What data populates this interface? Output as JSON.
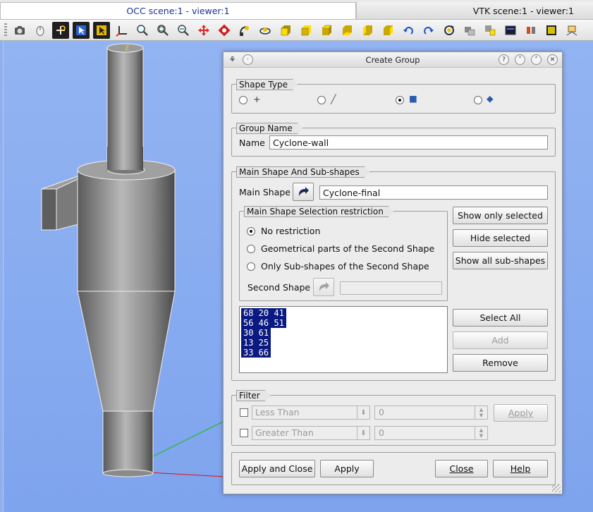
{
  "tabs": {
    "occ": "OCC scene:1 - viewer:1",
    "vtk": "VTK scene:1 - viewer:1"
  },
  "toolbar": {
    "icons": [
      "dump-view-icon",
      "mouse-icon",
      "fit-all-icon",
      "select-area-icon",
      "rectangle-zoom-icon",
      "global-pan-icon",
      "zoom-icon",
      "fit-area-icon",
      "zoom-out-icon",
      "pan-icon",
      "rotate-icon",
      "change-rotation-point-icon",
      "rotation-icon",
      "front-view-icon",
      "back-view-icon",
      "top-view-icon",
      "bottom-view-icon",
      "left-view-icon",
      "right-view-icon",
      "rotate-counterclockwise-icon",
      "rotate-clockwise-icon",
      "reset-view-icon",
      "clone-view-icon",
      "clipping-icon",
      "scaling-icon",
      "graduated-axes-icon",
      "trihedron-icon",
      "ray-tracing-icon"
    ]
  },
  "viewer": {
    "axis_label": "Z"
  },
  "dialog": {
    "title": "Create Group",
    "help_symbol": "?",
    "shape_type": {
      "legend": "Shape Type",
      "options": [
        {
          "symbol": "+",
          "selected": false
        },
        {
          "symbol": "╱",
          "selected": false
        },
        {
          "symbol": "■",
          "selected": true
        },
        {
          "symbol": "◆",
          "selected": false
        }
      ]
    },
    "group_name": {
      "legend": "Group Name",
      "label": "Name",
      "value": "Cyclone-wall"
    },
    "main_shape": {
      "legend": "Main Shape And Sub-shapes",
      "label": "Main Shape",
      "value": "Cyclone-final",
      "restriction": {
        "legend": "Main Shape Selection restriction",
        "options": [
          {
            "label": "No restriction",
            "selected": true
          },
          {
            "label": "Geometrical parts of the Second Shape",
            "selected": false
          },
          {
            "label": "Only Sub-shapes of the Second Shape",
            "selected": false
          }
        ],
        "second_shape_label": "Second Shape",
        "second_shape_value": ""
      },
      "buttons": {
        "show_only_selected": "Show only selected",
        "hide_selected": "Hide selected",
        "show_all": "Show all sub-shapes",
        "select_all": "Select All",
        "add": "Add",
        "remove": "Remove"
      },
      "ids": [
        "68  20  41",
        "56  46  51",
        "30  61",
        "13  25",
        "33  66"
      ]
    },
    "filter": {
      "legend": "Filter",
      "rows": [
        {
          "label": "Less Than",
          "value": "0",
          "checked": false
        },
        {
          "label": "Greater Than",
          "value": "0",
          "checked": false
        }
      ],
      "apply": "Apply"
    },
    "footer": {
      "apply_close": "Apply and Close",
      "apply": "Apply",
      "close": "Close",
      "help": "Help"
    }
  },
  "colors": {
    "viewer_bg": "#8fb0f0",
    "tab_text": "#1b2f9a",
    "selection": "#0b1a80",
    "x_axis": "#e01010",
    "y_axis": "#10c010",
    "z_axis": "#e0e010"
  }
}
